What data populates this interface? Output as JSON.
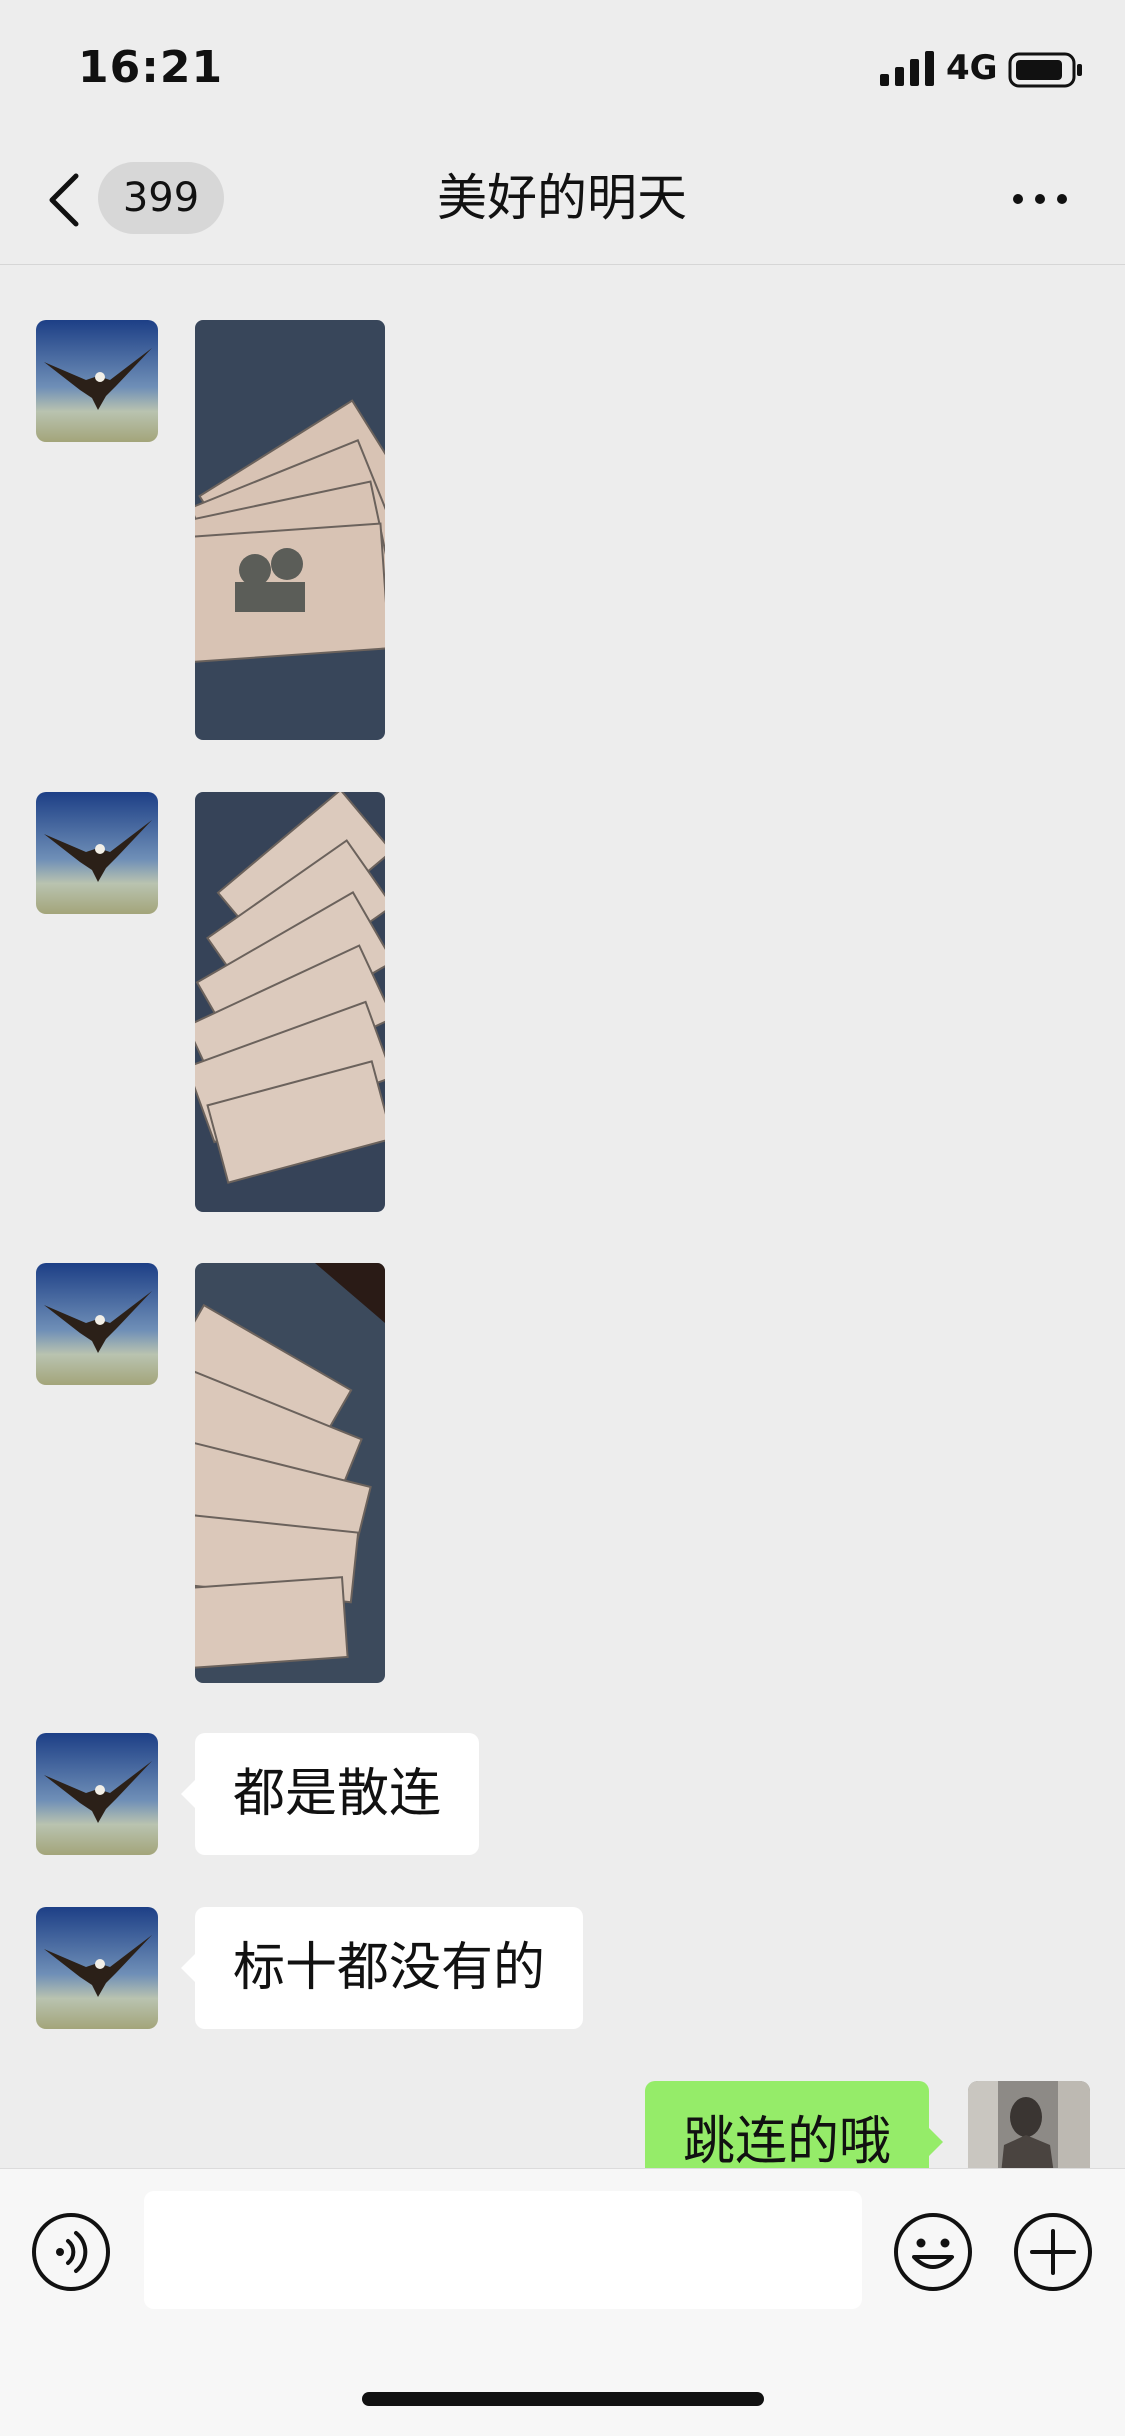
{
  "status_bar": {
    "time": "16:21",
    "network": "4G",
    "icons": [
      "signal-icon",
      "battery-icon"
    ]
  },
  "nav": {
    "unread_count": "399",
    "title": "美好的明天",
    "icons": [
      "back-icon",
      "more-icon"
    ]
  },
  "messages": [
    {
      "sender": "other",
      "type": "image",
      "avatar": "eagle-avatar"
    },
    {
      "sender": "other",
      "type": "image",
      "avatar": "eagle-avatar"
    },
    {
      "sender": "other",
      "type": "image",
      "avatar": "eagle-avatar"
    },
    {
      "sender": "other",
      "type": "text",
      "text": "都是散连",
      "avatar": "eagle-avatar"
    },
    {
      "sender": "other",
      "type": "text",
      "text": "标十都没有的",
      "avatar": "eagle-avatar"
    },
    {
      "sender": "self",
      "type": "text",
      "text": "跳连的哦",
      "avatar": "user-avatar"
    }
  ],
  "input_bar": {
    "placeholder": "",
    "icons": [
      "voice-icon",
      "emoji-icon",
      "plus-icon"
    ]
  },
  "colors": {
    "background": "#ededed",
    "incoming_bubble": "#ffffff",
    "outgoing_bubble": "#95ec69",
    "input_bar": "#f7f7f7"
  }
}
